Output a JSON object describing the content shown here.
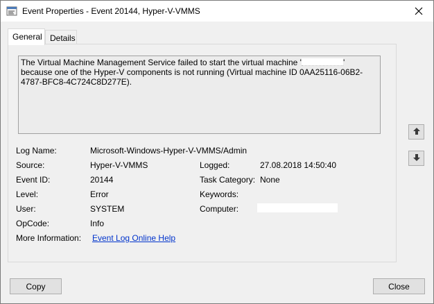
{
  "window": {
    "title": "Event Properties - Event 20144, Hyper-V-VMMS"
  },
  "tabs": [
    {
      "label": "General",
      "active": true
    },
    {
      "label": "Details",
      "active": false
    }
  ],
  "description": {
    "part1": "The Virtual Machine Management Service failed to start the virtual machine '",
    "part2": "' because one of the Hyper-V components is not running (Virtual machine ID 0AA25116-06B2-4787-BFC8-4C724C8D277E)."
  },
  "fields": {
    "log_name": {
      "label": "Log Name:",
      "value": "Microsoft-Windows-Hyper-V-VMMS/Admin"
    },
    "source": {
      "label": "Source:",
      "value": "Hyper-V-VMMS"
    },
    "logged": {
      "label": "Logged:",
      "value": "27.08.2018 14:50:40"
    },
    "event_id": {
      "label": "Event ID:",
      "value": "20144"
    },
    "task_category": {
      "label": "Task Category:",
      "value": "None"
    },
    "level": {
      "label": "Level:",
      "value": "Error"
    },
    "keywords": {
      "label": "Keywords:",
      "value": ""
    },
    "user": {
      "label": "User:",
      "value": "SYSTEM"
    },
    "computer": {
      "label": "Computer:",
      "value": ""
    },
    "opcode": {
      "label": "OpCode:",
      "value": "Info"
    },
    "more_info": {
      "label": "More Information:",
      "link": "Event Log Online Help"
    }
  },
  "buttons": {
    "copy": "Copy",
    "close": "Close"
  },
  "icons": {
    "title": "event-viewer-icon",
    "close": "close-icon",
    "up": "arrow-up-icon",
    "down": "arrow-down-icon"
  }
}
